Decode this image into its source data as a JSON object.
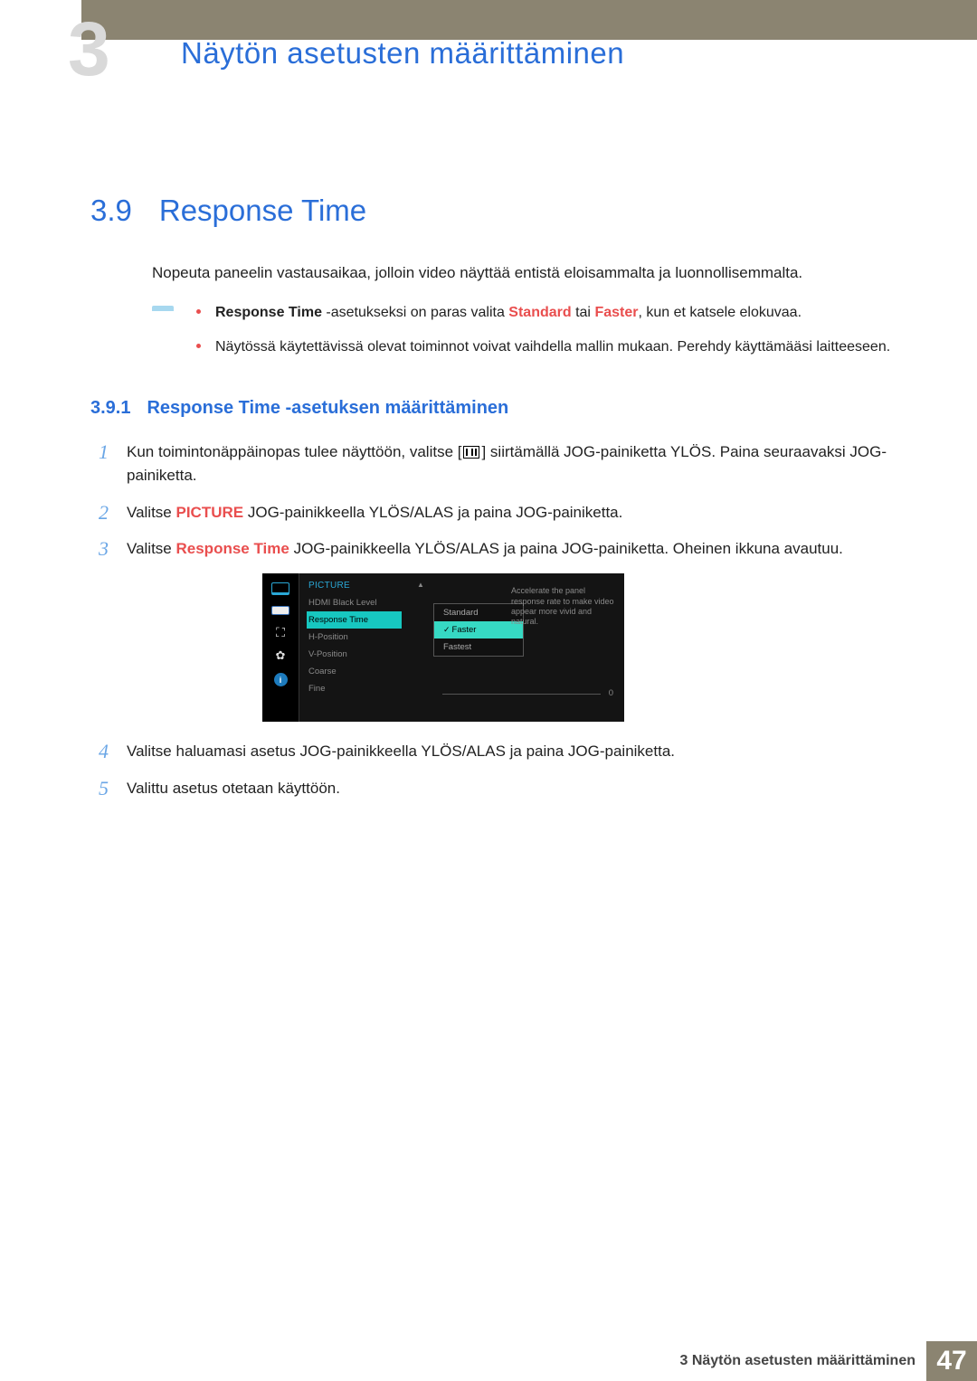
{
  "chapter": {
    "big_number": "3",
    "title": "Näytön asetusten määrittäminen"
  },
  "section": {
    "number": "3.9",
    "title": "Response Time",
    "intro": "Nopeuta paneelin vastausaikaa, jolloin video näyttää entistä eloisammalta ja luonnollisemmalta."
  },
  "notes": {
    "bullet1_part1": "Response Time",
    "bullet1_part2": " -asetukseksi on paras valita ",
    "bullet1_part3": "Standard",
    "bullet1_part4": " tai ",
    "bullet1_part5": "Faster",
    "bullet1_part6": ", kun et katsele elokuvaa.",
    "bullet2": "Näytössä käytettävissä olevat toiminnot voivat vaihdella mallin mukaan. Perehdy käyttämääsi laitteeseen."
  },
  "subsection": {
    "number": "3.9.1",
    "title": "Response Time -asetuksen määrittäminen"
  },
  "steps": {
    "s1_a": "Kun toimintonäppäinopas tulee näyttöön, valitse [",
    "s1_b": "] siirtämällä JOG-painiketta YLÖS. Paina seuraavaksi JOG-painiketta.",
    "s2_a": "Valitse ",
    "s2_b": "PICTURE",
    "s2_c": " JOG-painikkeella YLÖS/ALAS ja paina JOG-painiketta.",
    "s3_a": "Valitse ",
    "s3_b": "Response Time",
    "s3_c": " JOG-painikkeella YLÖS/ALAS ja paina JOG-painiketta. Oheinen ikkuna avautuu.",
    "s4": "Valitse haluamasi asetus JOG-painikkeella YLÖS/ALAS ja paina JOG-painiketta.",
    "s5": "Valittu asetus otetaan käyttöön."
  },
  "osd": {
    "title": "PICTURE",
    "rows": {
      "r1": "HDMI Black Level",
      "r2": "Response Time",
      "r3": "H-Position",
      "r4": "V-Position",
      "r5": "Coarse",
      "r6": "Fine"
    },
    "dropdown": {
      "d1": "Standard",
      "d2": "Faster",
      "d3": "Fastest"
    },
    "desc": "Accelerate the panel response rate to make video appear more vivid and natural.",
    "zero": "0",
    "arrow_up": "▲"
  },
  "footer": {
    "chapter_ref": "3 Näytön asetusten määrittäminen",
    "page": "47"
  }
}
